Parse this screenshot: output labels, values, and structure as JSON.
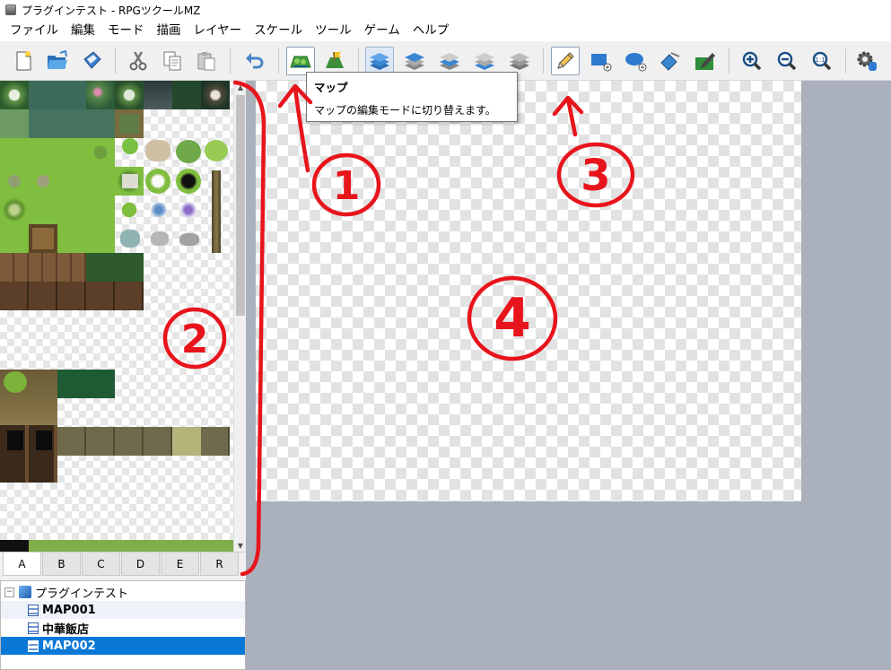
{
  "window": {
    "title": "プラグインテスト - RPGツクールMZ"
  },
  "menu": [
    "ファイル",
    "編集",
    "モード",
    "描画",
    "レイヤー",
    "スケール",
    "ツール",
    "ゲーム",
    "ヘルプ"
  ],
  "tooltip": {
    "title": "マップ",
    "description": "マップの編集モードに切り替えます。"
  },
  "tabs": [
    "A",
    "B",
    "C",
    "D",
    "E",
    "R"
  ],
  "tree": {
    "project": "プラグインテスト",
    "maps": [
      "MAP001",
      "中華飯店",
      "MAP002"
    ]
  },
  "annotations": [
    "1",
    "2",
    "3",
    "4"
  ],
  "colors": {
    "annotation": "#e8141c",
    "selection": "#0a78d7",
    "map_background": "#abb1bc"
  }
}
